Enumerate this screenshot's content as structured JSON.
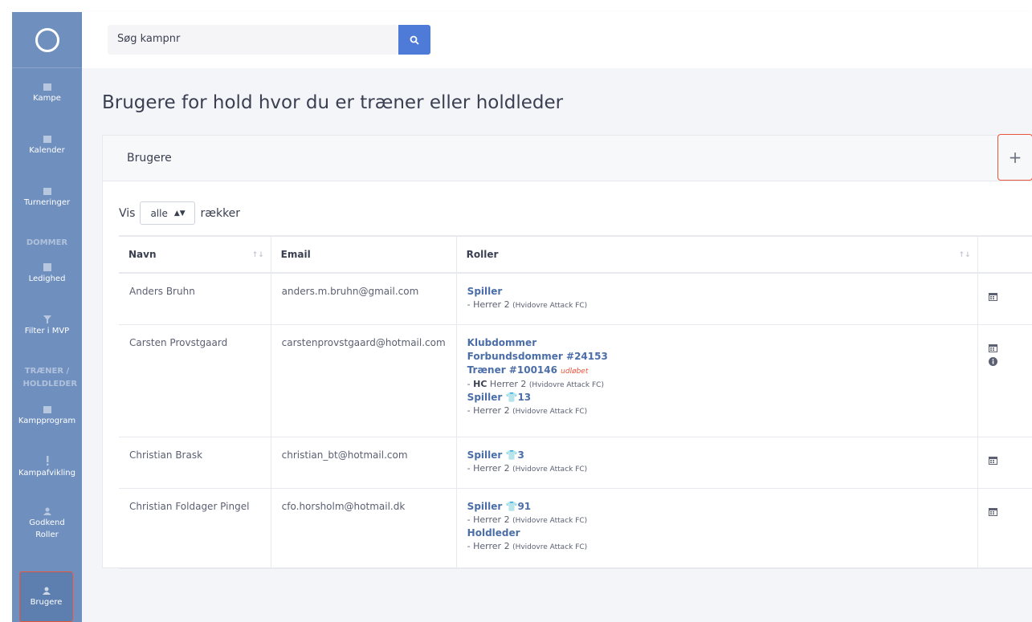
{
  "sidebar": {
    "items": [
      {
        "label": "Kampe",
        "icon": "calendar-icon"
      },
      {
        "label": "Kalender",
        "icon": "calendar-icon"
      },
      {
        "label": "Turneringer",
        "icon": "calendar-icon"
      },
      {
        "label": "Ledighed",
        "icon": "square-icon"
      },
      {
        "label": "Filter i MVP",
        "icon": "filter-icon"
      },
      {
        "label": "Kampprogram",
        "icon": "calendar-icon"
      },
      {
        "label": "Kampafvikling",
        "icon": "exclamation-icon"
      },
      {
        "label": "Godkend Roller",
        "icon": "user-icon"
      },
      {
        "label": "Brugere",
        "icon": "user-icon"
      }
    ],
    "sections": [
      "DOMMER",
      "TRÆNER / HOLDLEDER"
    ]
  },
  "search": {
    "placeholder": "Søg kampnr"
  },
  "page_title": "Brugere for hold hvor du er træner eller holdleder",
  "card": {
    "title": "Brugere",
    "add_label": "+"
  },
  "paging": {
    "prefix": "Vis",
    "selected": "alle",
    "suffix": "rækker"
  },
  "table": {
    "headers": [
      "Navn",
      "Email",
      "Roller"
    ],
    "rows": [
      {
        "name": "Anders Bruhn",
        "email": "anders.m.bruhn@gmail.com",
        "l1": "Spiller",
        "l2": "- Herrer 2",
        "l2s": "(Hvidovre Attack FC)"
      },
      {
        "name": "Carsten Provstgaard",
        "email": "carstenprovstgaard@hotmail.com",
        "l1": "Klubdommer",
        "l2": "Forbundsdommer #24153",
        "l3": "Træner #100146",
        "l3x": "udløbet",
        "l4a": "- ",
        "l4b": "HC",
        "l4c": " Herrer 2",
        "l4s": "(Hvidovre Attack FC)",
        "l5": "Spiller",
        "l5n": "13",
        "l6": "- Herrer 2",
        "l6s": "(Hvidovre Attack FC)"
      },
      {
        "name": "Christian Brask",
        "email": "christian_bt@hotmail.com",
        "l1": "Spiller",
        "l1n": "3",
        "l2": "- Herrer 2",
        "l2s": "(Hvidovre Attack FC)"
      },
      {
        "name": "Christian Foldager Pingel",
        "email": "cfo.horsholm@hotmail.dk",
        "l1": "Spiller",
        "l1n": "91",
        "l2": "- Herrer 2",
        "l2s": "(Hvidovre Attack FC)",
        "l3": "Holdleder",
        "l4": "- Herrer 2",
        "l4s": "(Hvidovre Attack FC)"
      }
    ]
  },
  "colors": {
    "sidebar": "#6f8fbe",
    "accent": "#4e7bd8",
    "highlight": "#e8553b",
    "role": "#4b6ea9"
  }
}
